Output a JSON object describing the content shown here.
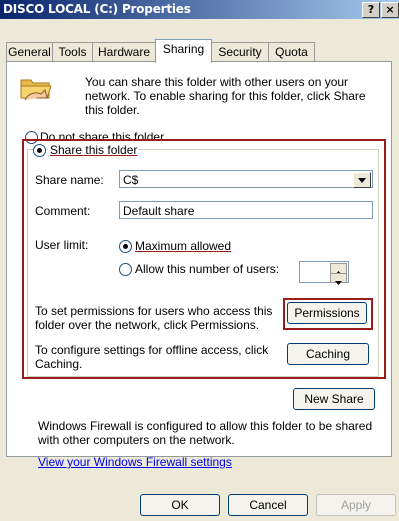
{
  "window": {
    "title": "DISCO LOCAL (C:) Properties",
    "help_label": "?",
    "close_label": "×"
  },
  "tabs": [
    {
      "label": "General"
    },
    {
      "label": "Tools"
    },
    {
      "label": "Hardware"
    },
    {
      "label": "Sharing"
    },
    {
      "label": "Security"
    },
    {
      "label": "Quota"
    }
  ],
  "sharing": {
    "intro_text": "You can share this folder with other users on your network.  To enable sharing for this folder, click Share this folder.",
    "do_not_share_label": "Do not share this folder",
    "share_label": "Share this folder",
    "share_name_label": "Share name:",
    "share_name_value": "C$",
    "comment_label": "Comment:",
    "comment_value": "Default share",
    "user_limit_label": "User limit:",
    "max_allowed_label": "Maximum allowed",
    "allow_number_label": "Allow this number of users:",
    "permissions_text": "To set permissions for users who access this folder over the network, click Permissions.",
    "permissions_button": "Permissions",
    "caching_text": "To configure settings for offline access, click Caching.",
    "caching_button": "Caching",
    "new_share_button": "New Share",
    "firewall_text": "Windows Firewall is configured to allow this folder to be shared with other computers on the network.",
    "firewall_link": "View your Windows Firewall settings"
  },
  "footer": {
    "ok_label": "OK",
    "cancel_label": "Cancel",
    "apply_label": "Apply"
  },
  "colors": {
    "highlight": "#9b1c1c",
    "title_start": "#0a246a",
    "title_end": "#a6caf0"
  }
}
